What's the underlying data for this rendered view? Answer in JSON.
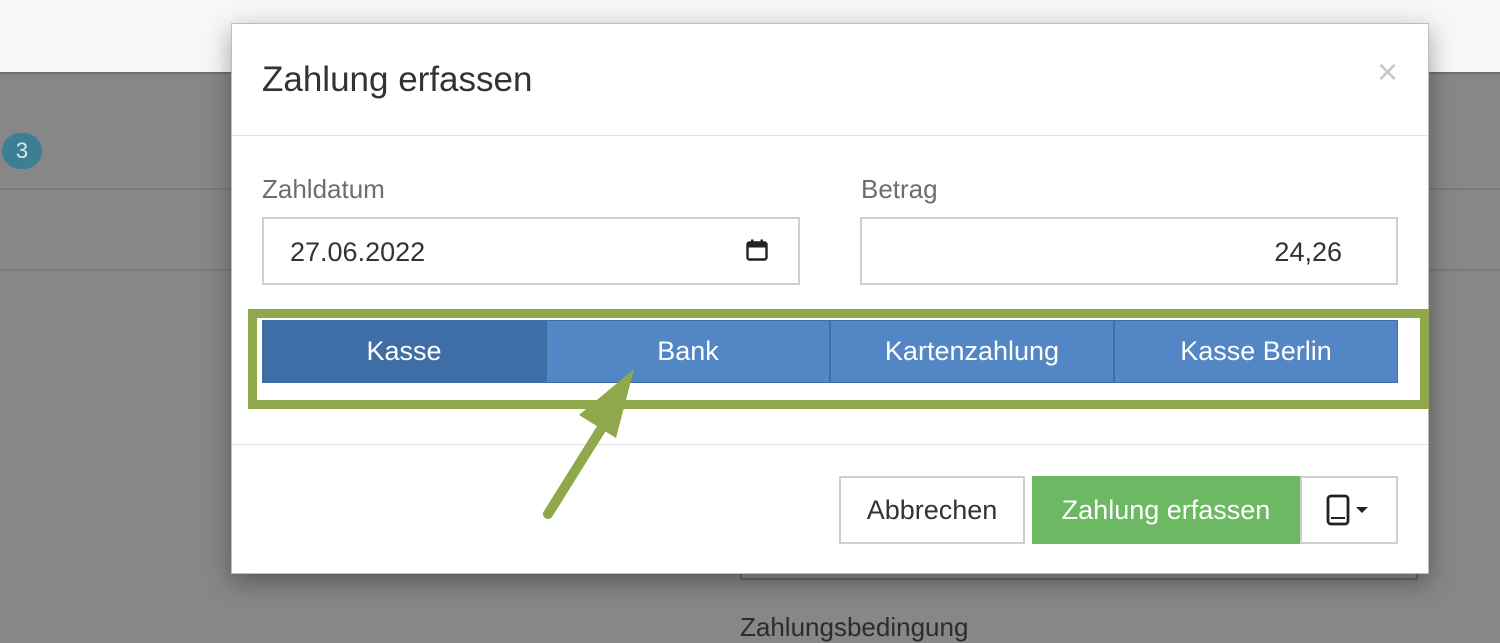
{
  "background": {
    "badge_count": "3",
    "partial_label": "Zahlungsbedingung"
  },
  "modal": {
    "title": "Zahlung erfassen",
    "close_glyph": "×",
    "date_label": "Zahldatum",
    "date_value": "27.06.2022",
    "amount_label": "Betrag",
    "amount_value": "24,26",
    "payment_methods": [
      "Kasse",
      "Bank",
      "Kartenzahlung",
      "Kasse Berlin"
    ],
    "selected_method": "Kasse",
    "cancel_label": "Abbrechen",
    "submit_label": "Zahlung erfassen",
    "device_icon": "tablet-icon"
  },
  "colors": {
    "highlight": "#8fa84c",
    "segment": "#5286c5",
    "segment_active": "#3f6ea6",
    "submit": "#6db863"
  }
}
